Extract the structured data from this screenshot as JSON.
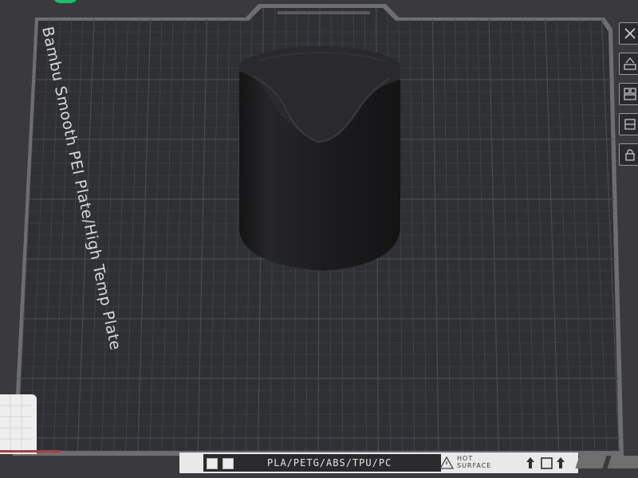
{
  "plate": {
    "name": "Bambu Smooth PEI Plate/High Temp Plate",
    "materials": "PLA/PETG/ABS/TPU/PC",
    "warning": [
      "HOT",
      "SURFACE"
    ]
  },
  "colors": {
    "plate_surface": "#2f3033",
    "grid_line": "#4a4b4f",
    "frame": "#6e6e70",
    "model": "#1d1d1f",
    "accent_red": "#c8332b",
    "accent_green": "#1bbf6b"
  },
  "right_toolbar": {
    "items": [
      {
        "icon": "close-icon"
      },
      {
        "icon": "auto-orient-icon"
      },
      {
        "icon": "arrange-icon"
      },
      {
        "icon": "plate-settings-icon"
      },
      {
        "icon": "lock-icon"
      }
    ]
  },
  "bottom_icons": [
    "upload-icon",
    "square-icon",
    "upload-icon"
  ],
  "model": {
    "name": "cylindrical-holder"
  }
}
